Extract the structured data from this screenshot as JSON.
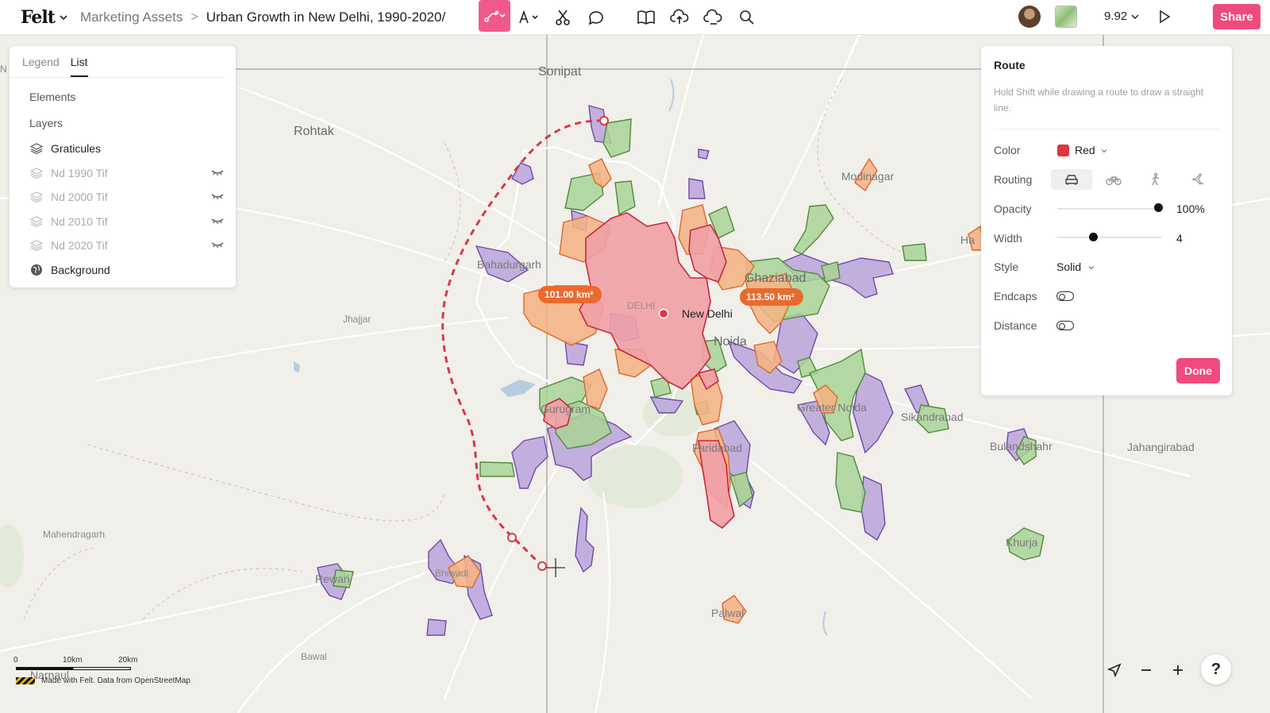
{
  "app": {
    "logo": "Felt",
    "breadcrumb_parent": "Marketing Assets",
    "breadcrumb_sep": ">",
    "map_title": "Urban Growth in New Delhi, 1990-2020/",
    "zoom_level": "9.92",
    "share_label": "Share"
  },
  "toolbar": {
    "icons": [
      "route-icon",
      "text-icon",
      "scissors-icon",
      "comment-icon",
      "book-icon",
      "upload-icon",
      "cloud-icon",
      "search-icon"
    ]
  },
  "left_panel": {
    "tabs": [
      "Legend",
      "List"
    ],
    "selected_tab": "List",
    "sections": {
      "elements": "Elements",
      "layers": "Layers"
    },
    "layers": [
      {
        "name": "Graticules",
        "dimmed": false
      },
      {
        "name": "Nd 1990 Tif",
        "dimmed": true
      },
      {
        "name": "Nd 2000 Tif",
        "dimmed": true
      },
      {
        "name": "Nd 2010 Tif",
        "dimmed": true
      },
      {
        "name": "Nd 2020 Tif",
        "dimmed": true
      },
      {
        "name": "Background",
        "dimmed": false
      }
    ]
  },
  "route_panel": {
    "title": "Route",
    "hint": "Hold Shift while drawing a route to draw a straight line.",
    "color_label": "Color",
    "color_value": "Red",
    "color_hex": "#d9363e",
    "routing_label": "Routing",
    "routing_options": [
      "car-icon",
      "bike-icon",
      "walk-icon",
      "plane-icon"
    ],
    "routing_selected": "car-icon",
    "opacity_label": "Opacity",
    "opacity_value": "100%",
    "opacity_fraction": 1.0,
    "width_label": "Width",
    "width_value": "4",
    "style_label": "Style",
    "style_value": "Solid",
    "endcaps_label": "Endcaps",
    "distance_label": "Distance",
    "done_label": "Done"
  },
  "map": {
    "city_labels": {
      "sonipat": "Sonipat",
      "rohtak": "Rohtak",
      "modinagar": "Modinagar",
      "bahadurgarh": "Bahadurgarh",
      "jhajjar": "Jhajjar",
      "delhi": "DELHI",
      "new_delhi": "New Delhi",
      "ghaziabad": "Ghaziabad",
      "noida": "Noida",
      "gurugram": "Gurugram",
      "greater_noida": "Greater Noida",
      "sikandrabad": "Sikandrabad",
      "bulandshahr": "Bulandshahr",
      "jahangirabad": "Jahangirabad",
      "faridabad": "Faridabad",
      "mahendragarh": "Mahendragarh",
      "rewari": "Rewari",
      "bhiwadi": "Bhiwadi",
      "palwal": "Palwal",
      "khurja": "Khurja",
      "bawal": "Bawal",
      "narnaul": "Narnaul",
      "hapur_partial": "Ha",
      "edge_n": "N"
    },
    "area_badges": [
      "101.00 km²",
      "113.50 km²"
    ],
    "palette": {
      "purple": "#b79fd9",
      "green": "#9dcb8b",
      "orange": "#f3b07f",
      "red": "#ee9aa0",
      "route": "#d63a45"
    }
  },
  "scale": {
    "zero": "0",
    "ten": "10km",
    "twenty": "20km"
  },
  "attribution": "Made with Felt. Data from OpenStreetMap"
}
